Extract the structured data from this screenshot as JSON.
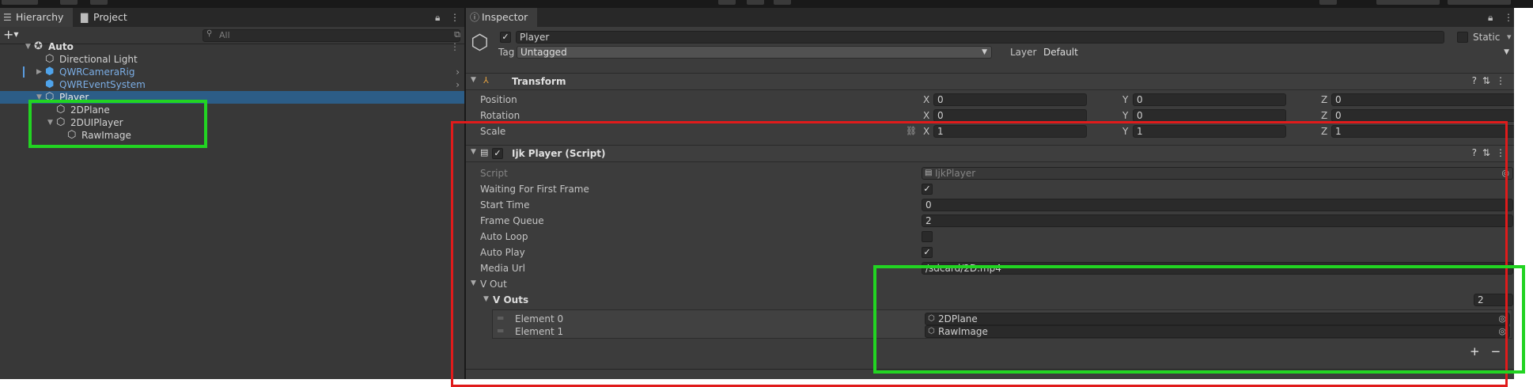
{
  "hierarchy": {
    "tabs": {
      "hierarchy": "Hierarchy",
      "project": "Project"
    },
    "search_placeholder": "All",
    "rows": {
      "scene": "Auto",
      "directional_light": "Directional Light",
      "camera_rig": "QWRCameraRig",
      "event_system": "QWREventSystem",
      "player": "Player",
      "plane": "2DPlane",
      "ui_player": "2DUIPlayer",
      "raw_image": "RawImage"
    }
  },
  "inspector": {
    "tab": "Inspector",
    "object_name": "Player",
    "static_label": "Static",
    "tag_label": "Tag",
    "tag_value": "Untagged",
    "layer_label": "Layer",
    "layer_value": "Default",
    "transform": {
      "title": "Transform",
      "position_label": "Position",
      "rotation_label": "Rotation",
      "scale_label": "Scale",
      "axis_x": "X",
      "axis_y": "Y",
      "axis_z": "Z",
      "position": {
        "x": "0",
        "y": "0",
        "z": "0"
      },
      "rotation": {
        "x": "0",
        "y": "0",
        "z": "0"
      },
      "scale": {
        "x": "1",
        "y": "1",
        "z": "1"
      }
    },
    "script_component": {
      "title": "Ijk Player (Script)",
      "script_label": "Script",
      "script_value": "IjkPlayer",
      "waiting_label": "Waiting For First Frame",
      "start_time_label": "Start Time",
      "start_time_value": "0",
      "frame_queue_label": "Frame Queue",
      "frame_queue_value": "2",
      "auto_loop_label": "Auto Loop",
      "auto_play_label": "Auto Play",
      "media_url_label": "Media Url",
      "media_url_value": "/sdcard/2D.mp4",
      "v_out_label": "V Out",
      "v_outs_label": "V Outs",
      "v_outs_count": "2",
      "elements": [
        {
          "label": "Element 0",
          "value": "2DPlane"
        },
        {
          "label": "Element 1",
          "value": "RawImage"
        }
      ],
      "add_btn": "+",
      "remove_btn": "−"
    }
  },
  "annotation_colors": {
    "green": "#22d422",
    "red": "#e01b1b"
  }
}
